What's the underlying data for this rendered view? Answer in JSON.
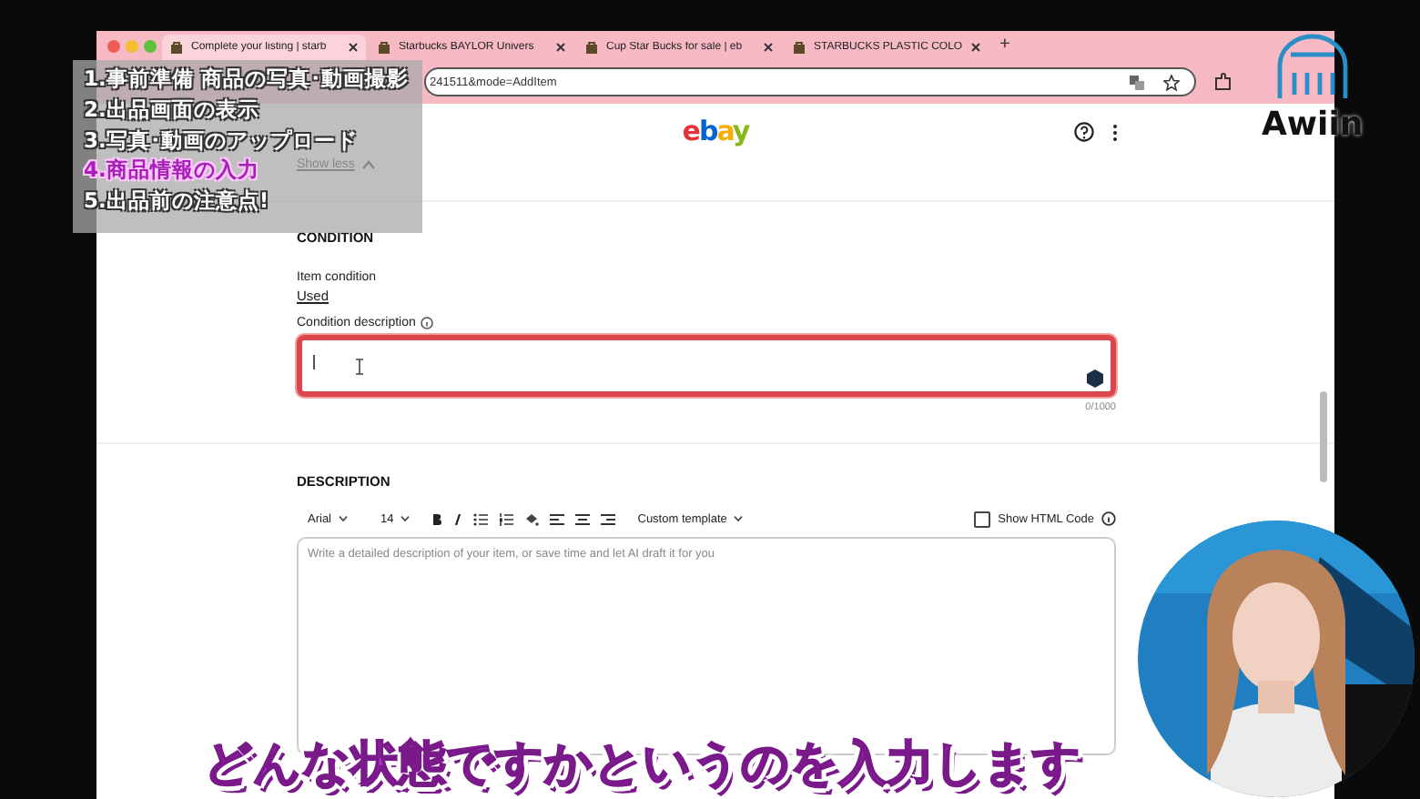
{
  "browser": {
    "tabs": [
      {
        "title": "Complete your listing | starb",
        "selected": true
      },
      {
        "title": "Starbucks BAYLOR Univers",
        "selected": false
      },
      {
        "title": "Cup Star Bucks for sale | eb",
        "selected": false
      },
      {
        "title": "STARBUCKS PLASTIC COLO",
        "selected": false
      }
    ],
    "new_tab": "+",
    "url": "241511&mode=AddItem"
  },
  "page": {
    "logo": "ebay",
    "show_less": "Show less",
    "condition": {
      "heading": "CONDITION",
      "item_condition_label": "Item condition",
      "item_condition_value": "Used",
      "description_label": "Condition description",
      "highlighted": true,
      "counter": "0/1000"
    },
    "description": {
      "heading": "DESCRIPTION",
      "font": "Arial",
      "size": "14",
      "template": "Custom template",
      "show_html": {
        "label": "Show HTML Code",
        "checked": false
      },
      "placeholder": "Write a detailed description of your item, or save time and let AI draft it for you"
    }
  },
  "overlay": {
    "chapters": [
      {
        "label": "1.事前準備 商品の写真･動画撮影",
        "selected": false
      },
      {
        "label": "2.出品画面の表示",
        "selected": false
      },
      {
        "label": "3.写真･動画のアップロード",
        "selected": false
      },
      {
        "label": "4.商品情報の入力",
        "selected": true
      },
      {
        "label": "5.出品前の注意点!",
        "selected": false
      }
    ],
    "brand": "Awiin",
    "caption": "どんな状態ですかというのを入力します"
  }
}
